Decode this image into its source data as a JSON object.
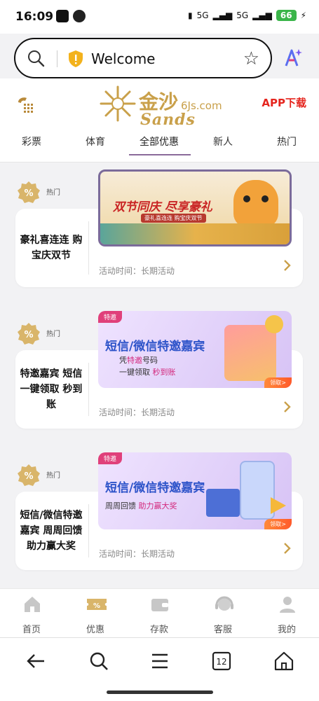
{
  "status_bar": {
    "time": "16:09",
    "battery": "66",
    "net1": "5G",
    "net2": "5G"
  },
  "address_bar": {
    "url": "Welcome"
  },
  "header": {
    "logo_cn": "金沙",
    "logo_domain": "6Js.com",
    "logo_en": "Sands",
    "app_download": "APP下载"
  },
  "tabs": [
    {
      "label": "彩票"
    },
    {
      "label": "体育"
    },
    {
      "label": "全部优惠",
      "active": true
    },
    {
      "label": "新人"
    },
    {
      "label": "热门"
    }
  ],
  "promos": [
    {
      "hot_label": "热门",
      "title": "豪礼喜连连 购宝庆双节",
      "time_label": "活动时间：长期活动",
      "banner": {
        "headline": "双节同庆 尽享豪礼",
        "sub": "豪礼喜连连 购宝庆双节"
      }
    },
    {
      "hot_label": "热门",
      "title": "特邀嘉宾 短信一键领取 秒到账",
      "time_label": "活动时间：长期活动",
      "banner": {
        "tag": "特邀",
        "headline": "短信/微信特邀嘉宾",
        "sub_line1_a": "凭",
        "sub_line1_b": "特邀",
        "sub_line1_c": "号码",
        "sub_line2_a": "一键领取",
        "sub_line2_b": "秒到账",
        "go": "领取>"
      }
    },
    {
      "hot_label": "热门",
      "title": "短信/微信特邀嘉宾 周周回馈助力赢大奖",
      "time_label": "活动时间：长期活动",
      "banner": {
        "tag": "特邀",
        "headline": "短信/微信特邀嘉宾",
        "sub_a": "周周回馈",
        "sub_b": "助力赢大奖",
        "go": "领取>"
      }
    }
  ],
  "app_nav": [
    {
      "label": "首页",
      "icon": "home-icon"
    },
    {
      "label": "优惠",
      "icon": "promo-ticket-icon"
    },
    {
      "label": "存款",
      "icon": "wallet-icon"
    },
    {
      "label": "客服",
      "icon": "headset-icon"
    },
    {
      "label": "我的",
      "icon": "user-icon"
    }
  ],
  "browser_nav": {
    "tab_count": "12"
  },
  "colors": {
    "accent_gold": "#c9a04a",
    "download_red": "#e5251e",
    "tab_underline": "#8a6a9a"
  }
}
